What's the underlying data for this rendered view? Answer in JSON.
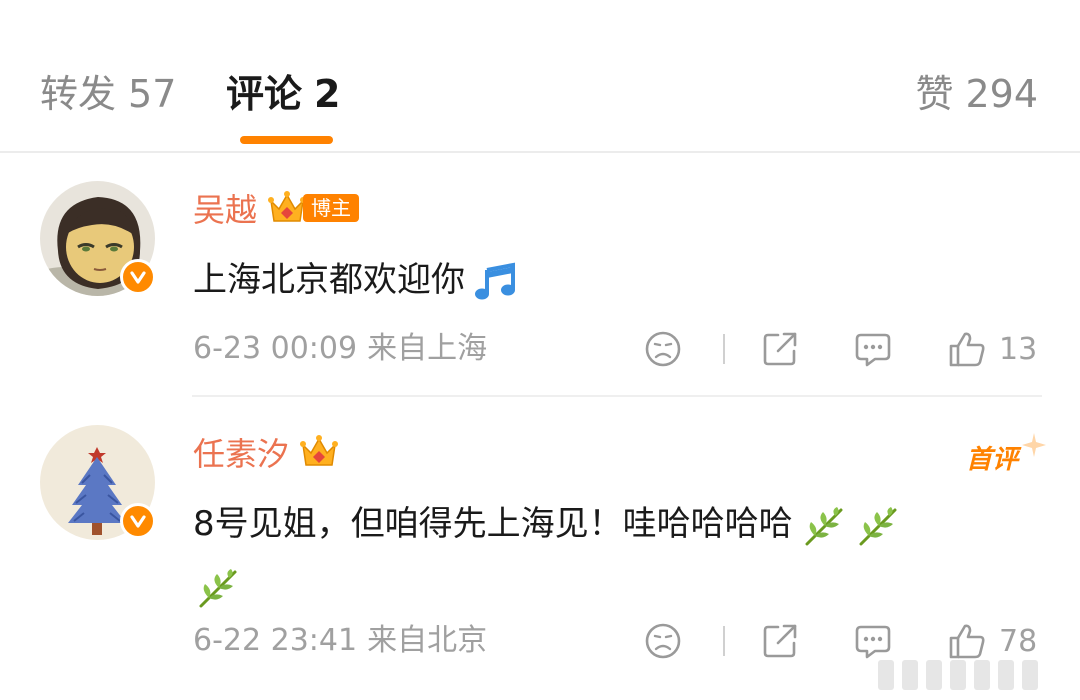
{
  "tabs": {
    "repost": {
      "label": "转发",
      "count": "57"
    },
    "comment": {
      "label": "评论",
      "count": "2"
    },
    "like": {
      "label": "赞",
      "count": "294"
    }
  },
  "colors": {
    "accent": "#ff8200",
    "username": "#eb7350",
    "meta": "#a0a0a0"
  },
  "comments": [
    {
      "username": "吴越",
      "badges": [
        "crown-icon",
        "author-badge"
      ],
      "author_badge_label": "博主",
      "verified": true,
      "text": "上海北京都欢迎你",
      "emojis": [
        "music-note-icon"
      ],
      "time": "6-23 00:09",
      "location": "来自上海",
      "likes": "13"
    },
    {
      "username": "任素汐",
      "badges": [
        "crown-icon"
      ],
      "first_comment_label": "首评",
      "verified": true,
      "text": "8号见姐，但咱得先上海见！哇哈哈哈哈",
      "emojis": [
        "leaf-branch-icon",
        "leaf-branch-icon",
        "leaf-branch-icon"
      ],
      "time": "6-22 23:41",
      "location": "来自北京",
      "likes": "78"
    }
  ]
}
